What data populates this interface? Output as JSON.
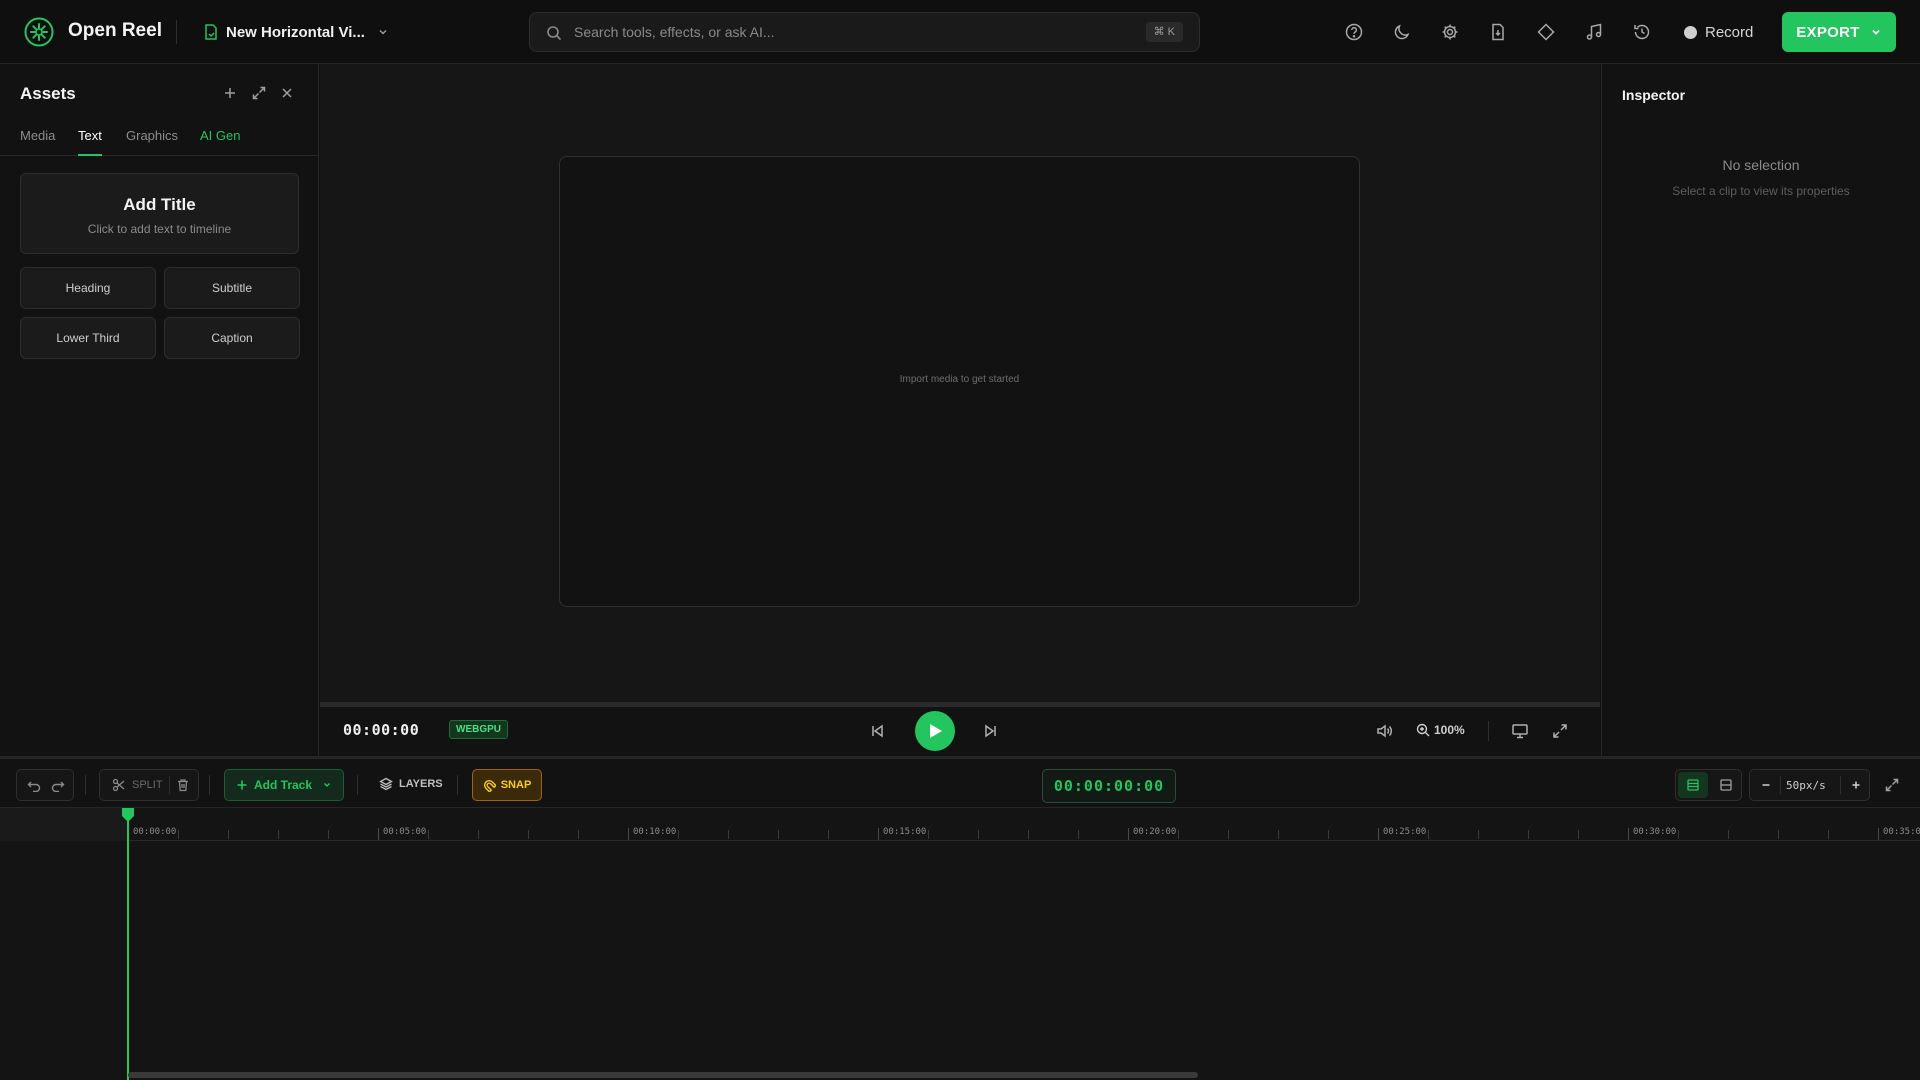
{
  "app": {
    "name": "Open Reel",
    "project_name": "New Horizontal Vi..."
  },
  "search": {
    "placeholder": "Search tools, effects, or ask AI...",
    "shortcut": "⌘ K"
  },
  "toolbar": {
    "icons": [
      "help-icon",
      "moon-icon",
      "gear-icon",
      "file-icon",
      "diamond-icon",
      "music-icon",
      "history-icon"
    ],
    "record_label": "Record",
    "export_label": "EXPORT"
  },
  "assets": {
    "title": "Assets",
    "tabs": [
      {
        "label": "Media"
      },
      {
        "label": "Text"
      },
      {
        "label": "Graphics"
      },
      {
        "label": "AI Gen"
      }
    ],
    "active_tab": "Text",
    "add_title": {
      "heading": "Add Title",
      "sub": "Click to add text to timeline"
    },
    "presets": [
      "Heading",
      "Subtitle",
      "Lower Third",
      "Caption"
    ]
  },
  "preview": {
    "empty_hint": "Import media to get started",
    "timecode": "00:00:00",
    "renderer_badge": "WEBGPU",
    "zoom": "100%"
  },
  "inspector": {
    "title": "Inspector",
    "empty_title": "No selection",
    "empty_sub": "Select a clip to view its properties"
  },
  "timeline": {
    "split_label": "SPLIT",
    "add_track_label": "Add Track",
    "layers_label": "LAYERS",
    "snap_label": "SNAP",
    "timecode": "00:00:00:00",
    "zoom_label": "50px/s",
    "ruler_labels": [
      "00:00:00",
      "00:05:00",
      "00:10:00",
      "00:15:00",
      "00:20:00",
      "00:25:00",
      "00:30:00",
      "00:35:0"
    ]
  },
  "colors": {
    "accent": "#22c55e",
    "snap": "#facc15",
    "background": "#121212"
  }
}
